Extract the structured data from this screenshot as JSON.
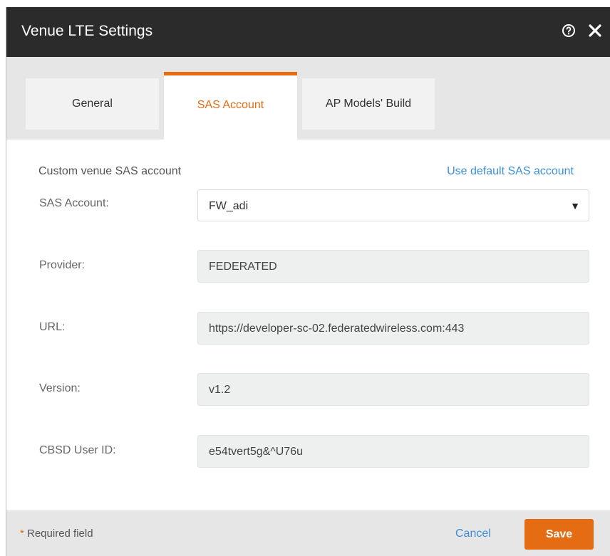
{
  "dialog": {
    "title": "Venue LTE Settings",
    "icons": {
      "help": "help-circle-icon",
      "close": "close-icon"
    }
  },
  "tabs": [
    {
      "label": "General",
      "active": false
    },
    {
      "label": "SAS Account",
      "active": true
    },
    {
      "label": "AP Models' Build",
      "active": false
    }
  ],
  "sas": {
    "section_label": "Custom venue SAS account",
    "default_link": "Use default SAS account",
    "account_label": "SAS Account:",
    "account_value": "FW_adi",
    "account_caret": "▼",
    "provider_label": "Provider:",
    "provider_value": "FEDERATED",
    "url_label": "URL:",
    "url_value": "https://developer-sc-02.federatedwireless.com:443",
    "version_label": "Version:",
    "version_value": "v1.2",
    "cbsd_label": "CBSD User ID:",
    "cbsd_value": "e54tvert5g&^U76u"
  },
  "footer": {
    "required_star": "*",
    "required_text": " Required field",
    "cancel_label": "Cancel",
    "save_label": "Save"
  },
  "colors": {
    "accent": "#e56c13",
    "link": "#3d8fd9",
    "header_bg": "#2b2b2b"
  }
}
